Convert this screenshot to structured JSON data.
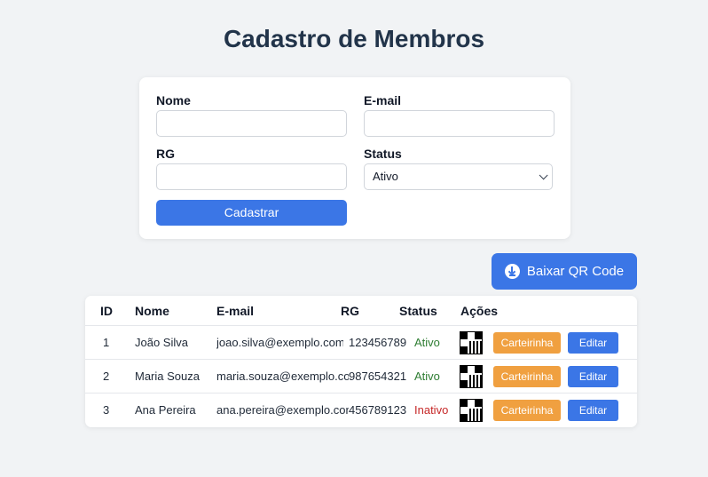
{
  "page": {
    "title": "Cadastro de Membros"
  },
  "form": {
    "nome": {
      "label": "Nome",
      "value": ""
    },
    "email": {
      "label": "E-mail",
      "value": ""
    },
    "rg": {
      "label": "RG",
      "value": ""
    },
    "status": {
      "label": "Status",
      "selected": "Ativo",
      "options": [
        "Ativo"
      ]
    },
    "submit_label": "Cadastrar"
  },
  "qr_button": {
    "label": "Baixar QR Code",
    "icon": "download-icon"
  },
  "table": {
    "headers": {
      "id": "ID",
      "nome": "Nome",
      "email": "E-mail",
      "rg": "RG",
      "status": "Status",
      "acoes": "Ações"
    },
    "rows": [
      {
        "id": "1",
        "nome": "João Silva",
        "email": "joao.silva@exemplo.com",
        "rg": "123456789",
        "status": "Ativo",
        "card_label": "Carteirinha",
        "edit_label": "Editar"
      },
      {
        "id": "2",
        "nome": "Maria Souza",
        "email": "maria.souza@exemplo.com",
        "rg": "987654321",
        "status": "Ativo",
        "card_label": "Carteirinha",
        "edit_label": "Editar"
      },
      {
        "id": "3",
        "nome": "Ana Pereira",
        "email": "ana.pereira@exemplo.com",
        "rg": "456789123",
        "status": "Inativo",
        "card_label": "Carteirinha",
        "edit_label": "Editar"
      }
    ]
  },
  "colors": {
    "primary": "#3b76e6",
    "card_button": "#f0a040",
    "active": "#2e7d32",
    "inactive": "#c62828"
  }
}
